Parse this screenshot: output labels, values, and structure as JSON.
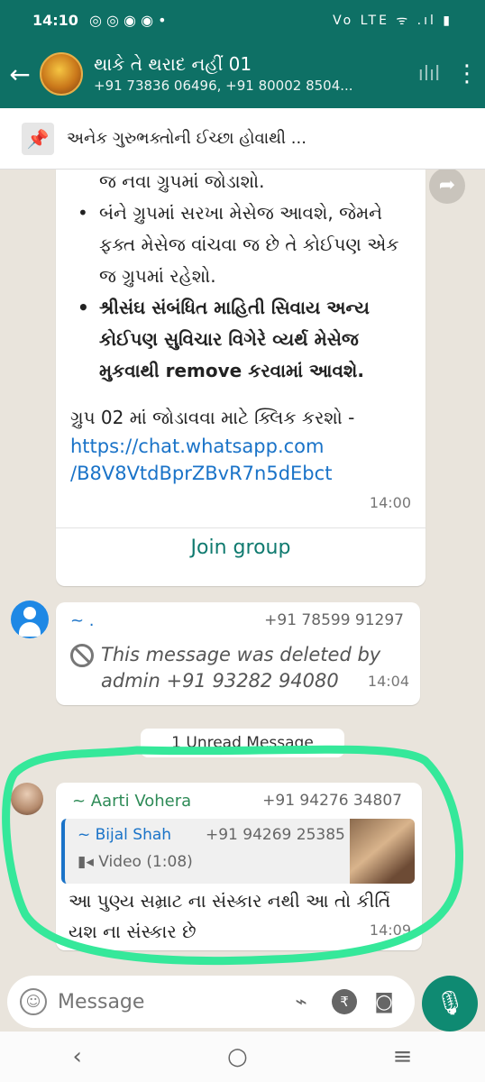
{
  "status": {
    "time": "14:10",
    "left_icons": "◎ ◎ ◉ ◉ •",
    "right_icons": "Vo LTE ᯤ .ıl ▮"
  },
  "header": {
    "title": "થાકે તે થરાદ નહીં 01",
    "subtitle": "+91 73836 06496, +91 80002 8504..."
  },
  "pinned": {
    "text": "અનેક ગુરુભક્તોની ઈચ્છા હોવાથી ..."
  },
  "message1": {
    "top_line": "જ નવા ગ્રુપમાં જોડાશો.",
    "bullet1": "બંને ગ્રુપમાં સરખા મેસેજ આવશે, જેમને ફક્ત મેસેજ વાંચવા જ છે તે કોઈપણ એક જ ગ્રુપમાં રહેશો.",
    "bullet2": "શ્રીસંઘ સંબંધિત માહિતી સિવાય અન્ય કોઈપણ સુવિચાર વિગેરે વ્યર્થ મેસેજ મુકવાથી remove કરવામાં આવશે.",
    "body": "ગ્રુપ 02 માં જોડાવવા માટે ક્લિક કરશો -",
    "link1": "https://chat.whatsapp.com",
    "link2": "/B8V8VtdBprZBvR7n5dEbct",
    "time": "14:00",
    "join": "Join group"
  },
  "message2": {
    "sender": "~ .",
    "phone": "+91 78599 91297",
    "text": "This message was deleted by admin +91 93282 94080",
    "time": "14:04"
  },
  "unread": "1 Unread Message",
  "message3": {
    "sender": "~ Aarti Vohera",
    "phone": "+91 94276 34807",
    "quote": {
      "name": "~ Bijal Shah",
      "phone": "+91 94269 25385",
      "media": "Video (1:08)"
    },
    "text": "આ પુણ્ય સમ્રાટ ના સંસ્કાર નથી આ તો કીર્તિ યશ ના સંસ્કાર છે",
    "time": "14:09"
  },
  "composer": {
    "placeholder": "Message"
  },
  "colors": {
    "header": "#0e7065",
    "accent": "#0f8a72",
    "highlight": "#35e89a"
  }
}
